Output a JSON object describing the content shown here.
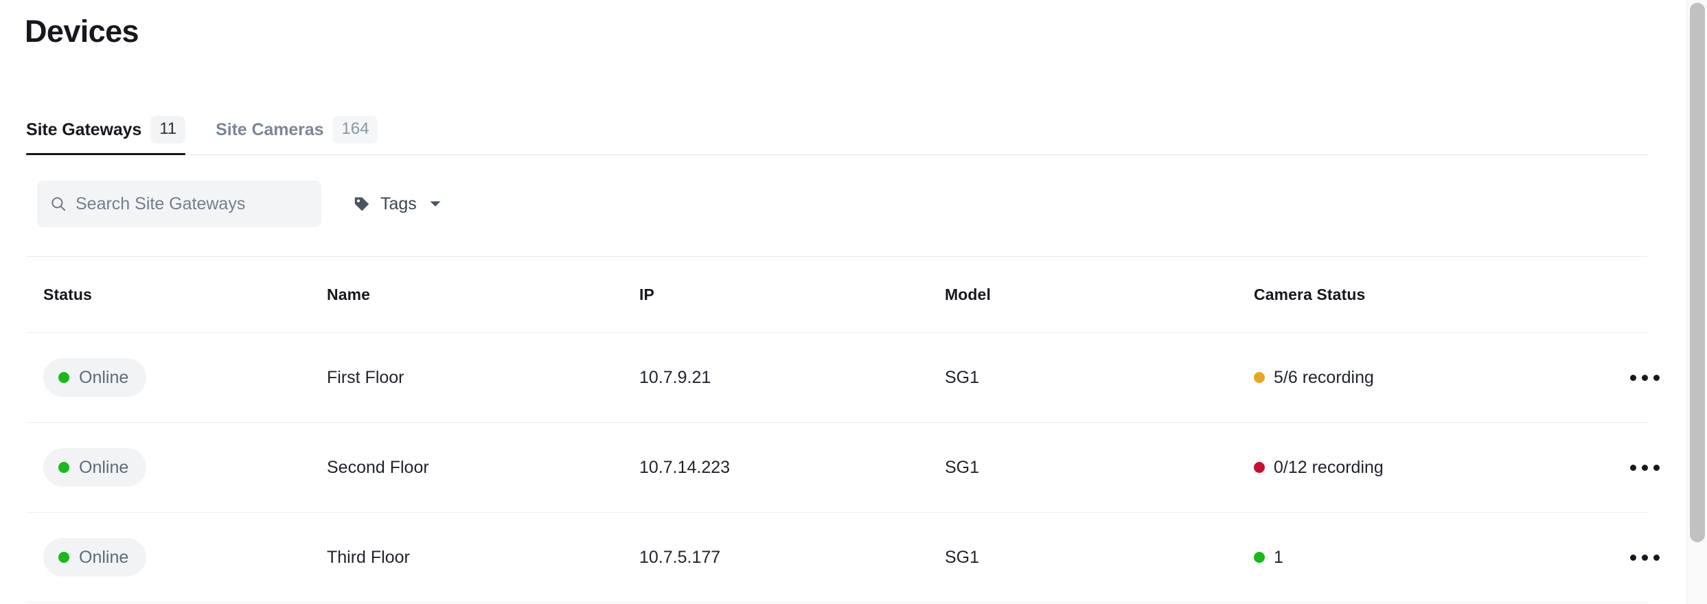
{
  "page": {
    "title": "Devices"
  },
  "tabs": [
    {
      "label": "Site Gateways",
      "count": "11",
      "active": true
    },
    {
      "label": "Site Cameras",
      "count": "164",
      "active": false
    }
  ],
  "toolbar": {
    "search_placeholder": "Search Site Gateways",
    "search_value": "",
    "tags_label": "Tags"
  },
  "table": {
    "columns": [
      {
        "key": "status",
        "label": "Status"
      },
      {
        "key": "name",
        "label": "Name"
      },
      {
        "key": "ip",
        "label": "IP"
      },
      {
        "key": "model",
        "label": "Model"
      },
      {
        "key": "camera_status",
        "label": "Camera Status"
      }
    ],
    "rows": [
      {
        "status_label": "Online",
        "status_color": "#19b919",
        "name": "First Floor",
        "ip": "10.7.9.21",
        "model": "SG1",
        "camera_status": "5/6 recording",
        "camera_status_color": "#e8a722"
      },
      {
        "status_label": "Online",
        "status_color": "#19b919",
        "name": "Second Floor",
        "ip": "10.7.14.223",
        "model": "SG1",
        "camera_status": "0/12 recording",
        "camera_status_color": "#c8102e"
      },
      {
        "status_label": "Online",
        "status_color": "#19b919",
        "name": "Third Floor",
        "ip": "10.7.5.177",
        "model": "SG1",
        "camera_status": "1",
        "camera_status_color": "#19b919"
      }
    ]
  },
  "colors": {
    "accent_active_tab": "#16181d",
    "text_primary": "#16181d",
    "text_muted": "#7b8794",
    "surface_chip": "#f2f4f6",
    "divider": "#e6e8eb",
    "status_online": "#19b919",
    "status_warning": "#e8a722",
    "status_error": "#c8102e"
  },
  "icons": {
    "search": "search-icon",
    "tag": "tag-icon",
    "caret_down": "chevron-down-icon",
    "overflow_menu": "ellipsis-icon"
  }
}
